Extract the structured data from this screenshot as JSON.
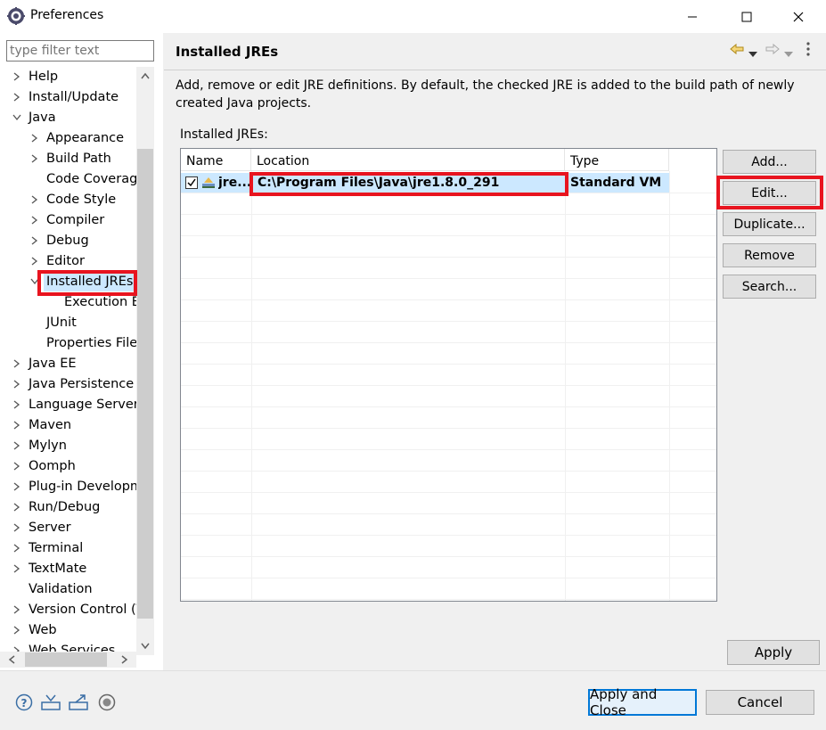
{
  "window": {
    "title": "Preferences",
    "app_icon": "eclipse-gear-icon",
    "controls": [
      "minimize-icon",
      "maximize-icon",
      "close-icon"
    ]
  },
  "left_pane": {
    "filter_placeholder": "type filter text",
    "tree": [
      {
        "label": "Help",
        "expand": "collapsed"
      },
      {
        "label": "Install/Update",
        "expand": "collapsed"
      },
      {
        "label": "Java",
        "expand": "expanded"
      },
      {
        "label": "Appearance",
        "expand": "collapsed"
      },
      {
        "label": "Build Path",
        "expand": "collapsed"
      },
      {
        "label": "Code Coverage",
        "expand": "none"
      },
      {
        "label": "Code Style",
        "expand": "collapsed"
      },
      {
        "label": "Compiler",
        "expand": "collapsed"
      },
      {
        "label": "Debug",
        "expand": "collapsed"
      },
      {
        "label": "Editor",
        "expand": "collapsed"
      },
      {
        "label": "Installed JREs",
        "expand": "expanded",
        "selected": true
      },
      {
        "label": "Execution Environments",
        "expand": "none"
      },
      {
        "label": "JUnit",
        "expand": "none"
      },
      {
        "label": "Properties Files Editor",
        "expand": "none"
      },
      {
        "label": "Java EE",
        "expand": "collapsed"
      },
      {
        "label": "Java Persistence",
        "expand": "collapsed"
      },
      {
        "label": "Language Servers",
        "expand": "collapsed"
      },
      {
        "label": "Maven",
        "expand": "collapsed"
      },
      {
        "label": "Mylyn",
        "expand": "collapsed"
      },
      {
        "label": "Oomph",
        "expand": "collapsed"
      },
      {
        "label": "Plug-in Development",
        "expand": "collapsed"
      },
      {
        "label": "Run/Debug",
        "expand": "collapsed"
      },
      {
        "label": "Server",
        "expand": "collapsed"
      },
      {
        "label": "Terminal",
        "expand": "collapsed"
      },
      {
        "label": "TextMate",
        "expand": "collapsed"
      },
      {
        "label": "Validation",
        "expand": "none"
      },
      {
        "label": "Version Control (Team)",
        "expand": "collapsed"
      },
      {
        "label": "Web",
        "expand": "collapsed"
      },
      {
        "label": "Web Services",
        "expand": "collapsed"
      }
    ]
  },
  "page": {
    "title": "Installed JREs",
    "nav_icons": [
      "back-arrow-icon",
      "back-menu-icon",
      "forward-arrow-icon",
      "forward-menu-icon",
      "view-menu-icon"
    ],
    "description": "Add, remove or edit JRE definitions. By default, the checked JRE is added to the build path of newly created Java projects.",
    "section_label": "Installed JREs:",
    "columns": [
      "Name",
      "Location",
      "Type"
    ],
    "rows": [
      {
        "checked": true,
        "name": "jre...",
        "location": "C:\\Program Files\\Java\\jre1.8.0_291",
        "type": "Standard VM"
      }
    ],
    "buttons": {
      "add": "Add...",
      "edit": "Edit...",
      "duplicate": "Duplicate...",
      "remove": "Remove",
      "search": "Search..."
    },
    "apply": "Apply"
  },
  "bottom": {
    "icons": [
      "help-icon",
      "import-icon",
      "export-icon",
      "record-icon"
    ],
    "apply_and_close": "Apply and Close",
    "cancel": "Cancel"
  },
  "colors": {
    "selection": "#cce8ff",
    "highlight_box": "#e8141f",
    "default_button_border": "#0078d7"
  }
}
